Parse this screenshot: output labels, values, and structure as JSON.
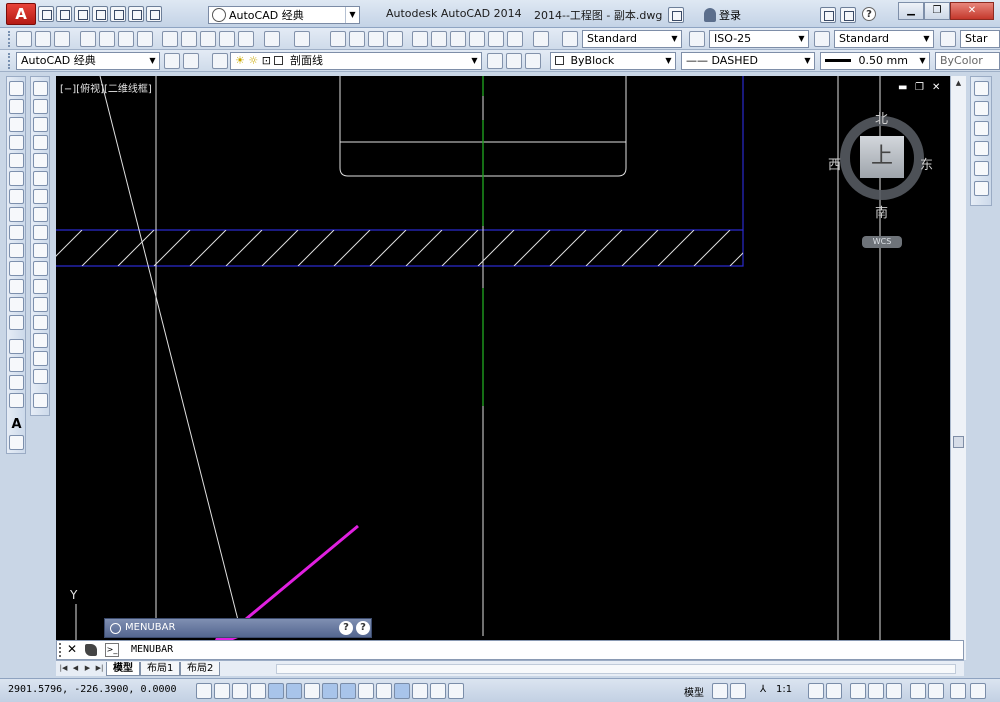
{
  "titlebar": {
    "logo": "A",
    "workspace": "AutoCAD 经典",
    "app_title": "Autodesk AutoCAD 2014",
    "file_title": "2014--工程图 - 副本.dwg",
    "login": "登录",
    "help": "?"
  },
  "toolbar2": {
    "text_style": "Standard",
    "dim_style": "ISO-25",
    "table_style": "Standard",
    "multileader_style": "Star"
  },
  "toolbar3": {
    "workspace": "AutoCAD 经典",
    "layer": "剖面线",
    "color": "ByBlock",
    "linetype": "—— DASHED",
    "lineweight": "0.50 mm",
    "plotstyle": "ByColor"
  },
  "viewport": {
    "label": "[−][俯视][二维线框]",
    "ctrl_min": "▬",
    "ctrl_restore": "❐",
    "ctrl_close": "✕",
    "compass": {
      "north": "北",
      "south": "南",
      "east": "东",
      "west": "西"
    },
    "cube_face": "上",
    "wcs": "WCS",
    "ucs_y": "Y"
  },
  "menubar_palette": {
    "title": "MENUBAR",
    "help1": "?",
    "help2": "?"
  },
  "command_line": {
    "close": "✕",
    "prompt": ">_",
    "text": "MENUBAR"
  },
  "tabs": [
    {
      "label": "模型",
      "active": true
    },
    {
      "label": "布局1",
      "active": false
    },
    {
      "label": "布局2",
      "active": false
    }
  ],
  "statusbar": {
    "coords": "2901.5796, -226.3900, 0.0000",
    "model": "模型",
    "scale": "1:1"
  },
  "colors": {
    "canvas": "#000000",
    "hatch_boundary": "#2a2acc",
    "center_line": "#1e9e1e",
    "geometry": "#e0e0e0",
    "annotation_arrow": "#e020e0",
    "close_button": "#c4382c"
  }
}
